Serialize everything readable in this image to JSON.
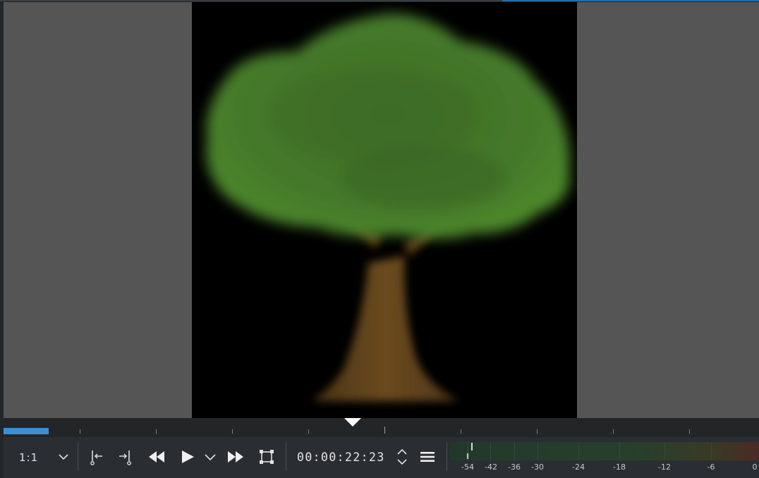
{
  "monitor": {
    "zoom": "1:1",
    "timecode": "00:00:22:23",
    "zone_in_fraction": 0.06,
    "playhead_fraction": 0.46
  },
  "toolbar": {
    "icons": [
      "zoom-dropdown-icon",
      "set-zone-in-icon",
      "set-zone-out-icon",
      "rewind-icon",
      "play-icon",
      "play-options-icon",
      "fast-forward-icon",
      "fit-frame-icon",
      "timecode-stepper-icon",
      "menu-icon"
    ]
  },
  "audio_meter": {
    "labels": [
      "-54",
      "-42",
      "-36",
      "-30",
      "-24",
      "-18",
      "-12",
      "-6",
      "0"
    ]
  },
  "colors": {
    "accent": "#3d8fd1",
    "background": "#232629",
    "monitor_background": "#555555"
  }
}
